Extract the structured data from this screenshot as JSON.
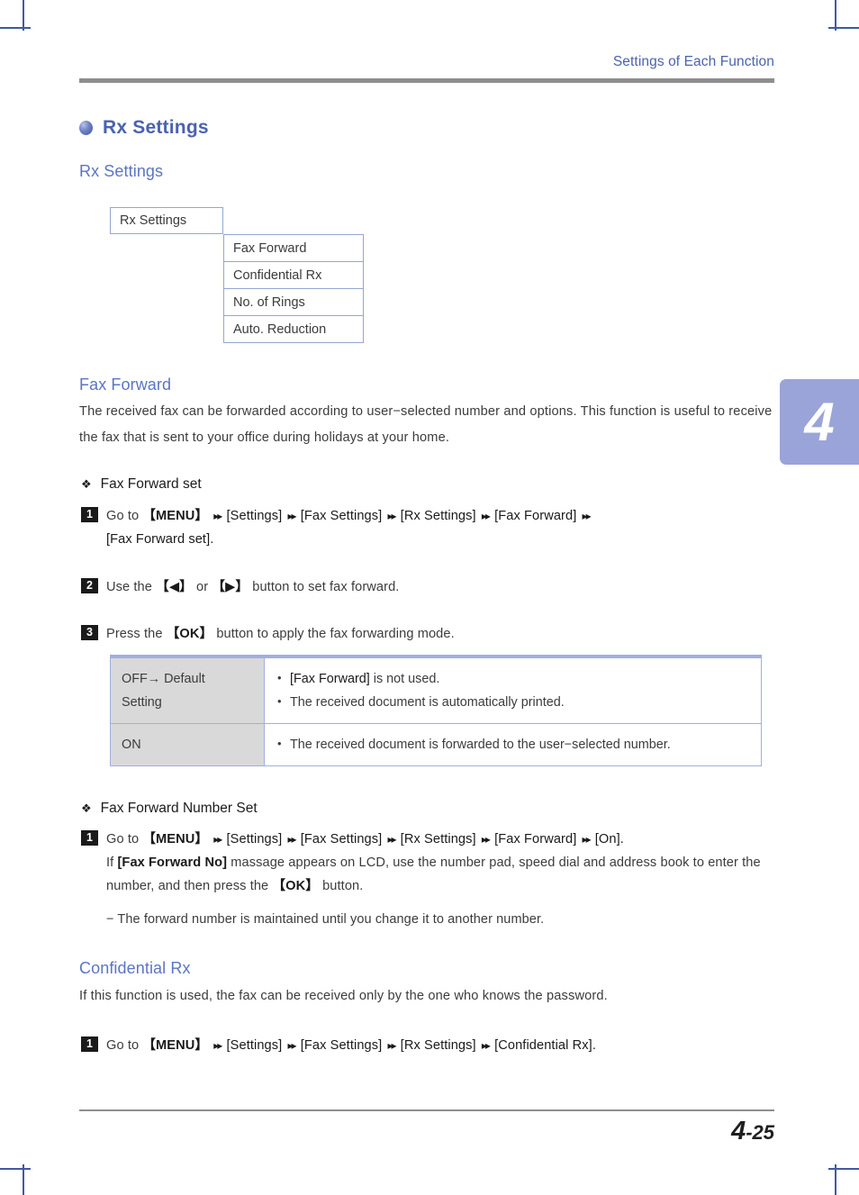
{
  "header": {
    "running_head": "Settings of Each Function",
    "chapter_tab": "4"
  },
  "section": {
    "h1_title": "Rx Settings",
    "h2_rx_settings": "Rx Settings",
    "h2_fax_forward": "Fax Forward",
    "h2_confidential_rx": "Confidential Rx"
  },
  "menu_map": {
    "parent": "Rx Settings",
    "children": [
      "Fax Forward",
      "Confidential Rx",
      "No. of Rings",
      "Auto. Reduction"
    ]
  },
  "fax_forward": {
    "intro": "The received fax can be forwarded according to user−selected number and options. This function is useful to receive the fax that is sent to your office during holidays at your home.",
    "subhead_set": "Fax Forward set",
    "subhead_number_set": "Fax Forward Number Set",
    "steps": {
      "s1_num": "1",
      "s1_lead": "Go to",
      "s1_menu": "【MENU】",
      "s1_p1": "[Settings]",
      "s1_p2": "[Fax Settings]",
      "s1_p3": "[Rx Settings]",
      "s1_p4": "[Fax Forward]",
      "s1_p5": "[Fax Forward set].",
      "s2_num": "2",
      "s2_a": "Use the",
      "s2_left": "【◀】",
      "s2_or": "or",
      "s2_right": "【▶】",
      "s2_b": "button to set fax forward.",
      "s3_num": "3",
      "s3_a": "Press the",
      "s3_ok": "【OK】",
      "s3_b": "button to apply the fax forwarding mode."
    },
    "number_set": {
      "num": "1",
      "lead": "Go to",
      "menu": "【MENU】",
      "p1": "[Settings]",
      "p2": "[Fax Settings]",
      "p3": "[Rx Settings]",
      "p4": "[Fax Forward]",
      "p5": "[On].",
      "line2_a": "If",
      "line2_key": "[Fax Forward No]",
      "line2_b": "massage appears on LCD, use the number pad, speed dial and address book to enter the number, and then press the",
      "line2_ok": "【OK】",
      "line2_c": "button.",
      "note": "− The forward number is maintained until you change it to another number."
    }
  },
  "option_table": {
    "rows": [
      {
        "key": "OFF→ Default\nSetting",
        "bullets": [
          {
            "key_part": "[Fax Forward]",
            "rest": " is not used."
          },
          {
            "key_part": "",
            "rest": "The received document is automatically printed."
          }
        ]
      },
      {
        "key": "ON",
        "bullets": [
          {
            "key_part": "",
            "rest": "The received document is forwarded to the user−selected number."
          }
        ]
      }
    ]
  },
  "confidential_rx": {
    "intro": "If this function is used, the fax can be received only by the one who knows the password.",
    "step": {
      "num": "1",
      "lead": "Go to",
      "menu": "【MENU】",
      "p1": "[Settings]",
      "p2": "[Fax Settings]",
      "p3": "[Rx Settings]",
      "p4": "[Confidential Rx]."
    }
  },
  "footer": {
    "page_major": "4",
    "page_minor": "-25"
  },
  "icons": {
    "bullet_sphere": "sphere-bullet-icon",
    "diamond": "❖",
    "arrow": "▸▸"
  },
  "colors": {
    "accent_blue": "#4a63ae",
    "heading_blue": "#5b75c4",
    "table_border": "#a3aede",
    "table_key_bg": "#d9d9d9",
    "tab_bg": "#9aa4d8",
    "rule_gray": "#8e8e8e"
  }
}
